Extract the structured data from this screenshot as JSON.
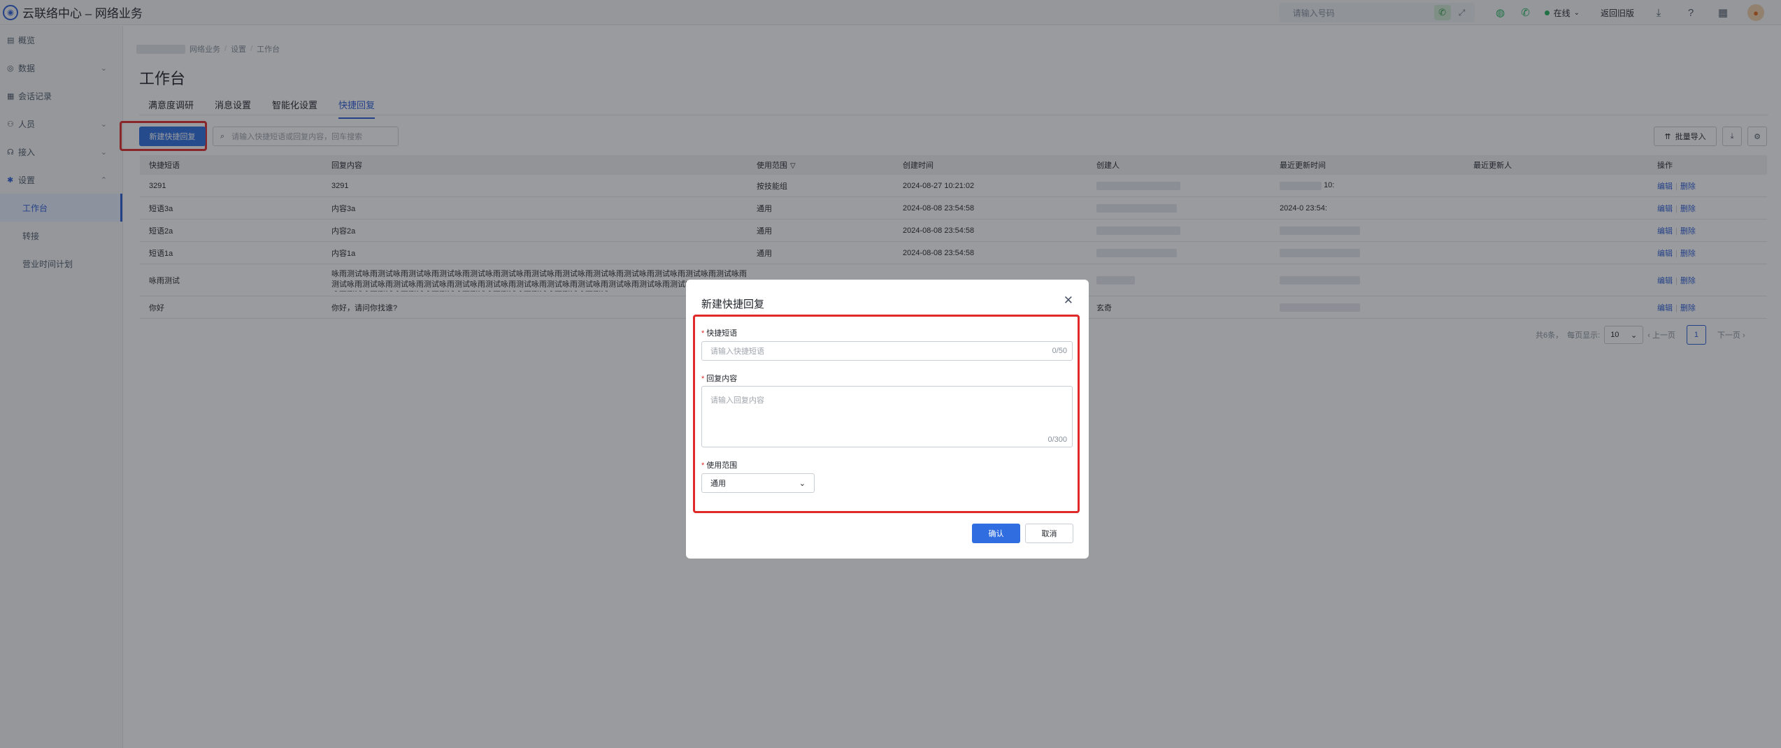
{
  "app": {
    "title": "云联络中心 – 网络业务",
    "logo_glyph": "◉"
  },
  "topbar": {
    "phone_placeholder": "请输入号码",
    "status_label": "在线",
    "back_old_label": "返回旧版",
    "icons": [
      "wechat-icon",
      "phone-icon",
      "download-icon",
      "help-icon",
      "grid-icon"
    ]
  },
  "sidebar": {
    "items": [
      {
        "label": "概览",
        "icon": "▤"
      },
      {
        "label": "数据",
        "icon": "◎"
      },
      {
        "label": "会话记录",
        "icon": "▦"
      },
      {
        "label": "人员",
        "icon": "⚇"
      },
      {
        "label": "接入",
        "icon": "☊"
      },
      {
        "label": "设置",
        "icon": "✱"
      }
    ],
    "sub_items": [
      {
        "label": "工作台"
      },
      {
        "label": "转接"
      },
      {
        "label": "营业时间计划"
      }
    ]
  },
  "breadcrumb": {
    "items": [
      "网络业务",
      "设置",
      "工作台"
    ]
  },
  "page": {
    "title": "工作台"
  },
  "tabs": [
    "满意度调研",
    "消息设置",
    "智能化设置",
    "快捷回复"
  ],
  "toolbar": {
    "new_button_label": "新建快捷回复",
    "search_placeholder": "请输入快捷短语或回复内容，回车搜索",
    "import_label": "批量导入"
  },
  "table": {
    "columns": [
      "快捷短语",
      "回复内容",
      "使用范围",
      "创建时间",
      "创建人",
      "最近更新时间",
      "最近更新人",
      "操作"
    ],
    "rows": [
      {
        "phrase": "3291",
        "content": "3291",
        "scope": "按技能组",
        "created": "2024-08-27 10:21:02",
        "creator": "",
        "updated": "10:",
        "updater": ""
      },
      {
        "phrase": "短语3a",
        "content": "内容3a",
        "scope": "通用",
        "created": "2024-08-08 23:54:58",
        "creator": "",
        "updated": "2024-0 23:54:",
        "updater": ""
      },
      {
        "phrase": "短语2a",
        "content": "内容2a",
        "scope": "通用",
        "created": "2024-08-08 23:54:58",
        "creator": "",
        "updated": "",
        "updater": ""
      },
      {
        "phrase": "短语1a",
        "content": "内容1a",
        "scope": "通用",
        "created": "2024-08-08 23:54:58",
        "creator": "",
        "updated": "",
        "updater": ""
      },
      {
        "phrase": "咏雨测试",
        "content": "咏雨测试咏雨测试咏雨测试咏雨测试咏雨测试咏雨测试咏雨测试咏雨测试咏雨测试咏雨测试咏雨测试咏雨测试咏雨测试咏雨测试咏雨测试咏雨测试咏雨测试咏雨测试咏雨测试咏雨测试咏雨测试咏雨测试咏雨测试咏雨测试咏雨测试咏雨测试咏雨测试咏雨测试咏雨测试咏雨测试咏雨测试咏雨测试咏雨测试咏雨测试咏雨测试咏雨测试",
        "scope": "",
        "created": "",
        "creator": "",
        "updated": "",
        "updater": ""
      },
      {
        "phrase": "你好",
        "content": "你好，请问你找谁?",
        "scope": "",
        "created": "",
        "creator": "玄奇",
        "updated": "",
        "updater": ""
      }
    ],
    "action_edit": "编辑",
    "action_delete": "删除"
  },
  "pager": {
    "total_text": "共6条，",
    "page_size_label": "每页显示:",
    "page_size": "10",
    "prev_label": "上一页",
    "current_page": "1",
    "next_label": "下一页"
  },
  "modal": {
    "title": "新建快捷回复",
    "phrase_label": "快捷短语",
    "phrase_placeholder": "请输入快捷短语",
    "phrase_count": "0/50",
    "content_label": "回复内容",
    "content_placeholder": "请输入回复内容",
    "content_count": "0/300",
    "scope_label": "使用范围",
    "scope_value": "通用",
    "confirm_label": "确认",
    "cancel_label": "取消"
  },
  "colors": {
    "primary": "#2f6de0",
    "highlight_border": "#e02a2a",
    "status_online": "#23b55d"
  }
}
